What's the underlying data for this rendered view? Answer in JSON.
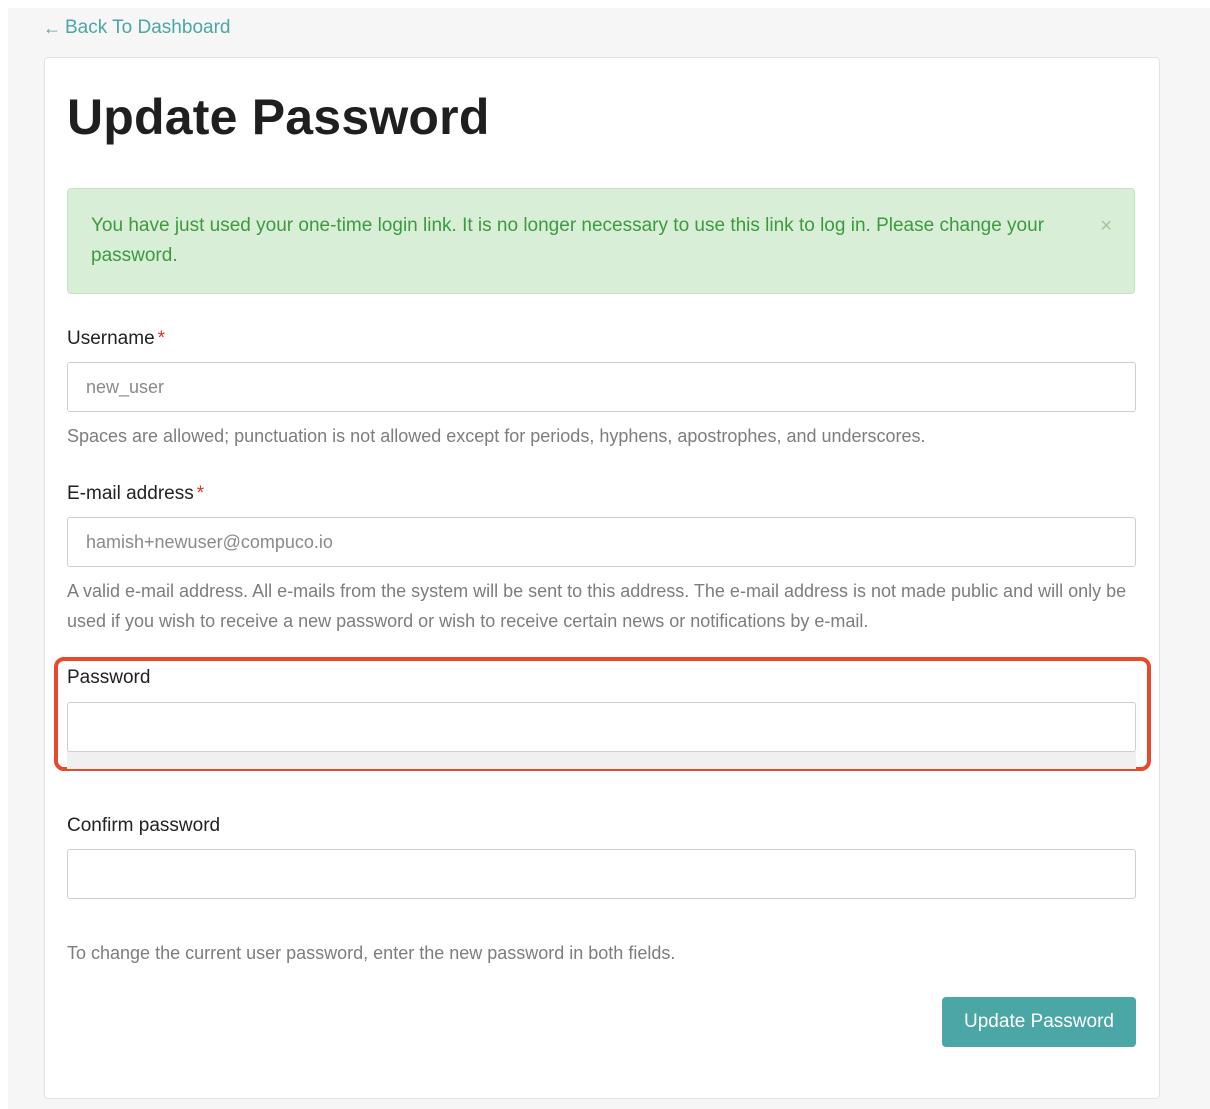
{
  "nav": {
    "back_arrow": "←",
    "back_label": "Back To Dashboard"
  },
  "page_title": "Update Password",
  "alert": {
    "message": "You have just used your one-time login link. It is no longer necessary to use this link to log in. Please change your password.",
    "close_symbol": "×"
  },
  "form": {
    "username": {
      "label": "Username",
      "required_mark": "*",
      "value": "new_user",
      "help": "Spaces are allowed; punctuation is not allowed except for periods, hyphens, apostrophes, and underscores."
    },
    "email": {
      "label": "E-mail address",
      "required_mark": "*",
      "value": "hamish+newuser@compuco.io",
      "help": "A valid e-mail address. All e-mails from the system will be sent to this address. The e-mail address is not made public and will only be used if you wish to receive a new password or wish to receive certain news or notifications by e-mail."
    },
    "password": {
      "label": "Password",
      "value": ""
    },
    "confirm_password": {
      "label": "Confirm password",
      "value": ""
    },
    "password_help": "To change the current user password, enter the new password in both fields.",
    "submit_label": "Update Password"
  },
  "colors": {
    "accent": "#4aa7a5",
    "alert_bg": "#d9eed6",
    "alert_text": "#3c9a3f",
    "required": "#d9322b",
    "highlight": "#e8492b"
  }
}
